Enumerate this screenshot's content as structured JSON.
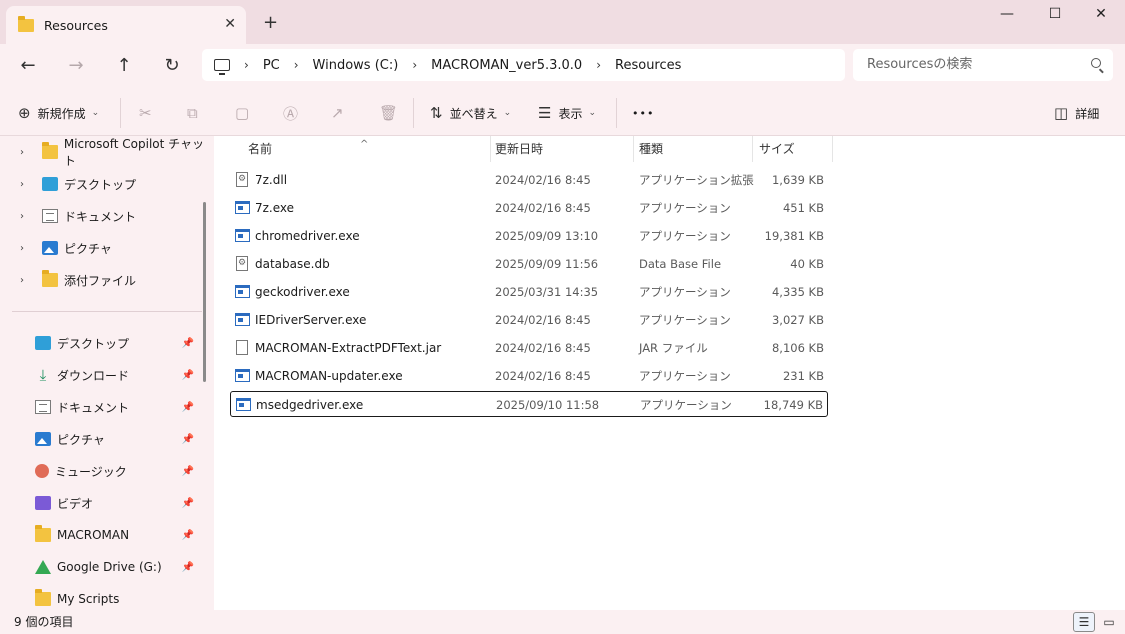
{
  "tab": {
    "title": "Resources"
  },
  "window": {
    "minimize": "—",
    "maximize": "☐",
    "close": "✕",
    "new_tab": "+"
  },
  "address": {
    "crumbs": [
      "PC",
      "Windows (C:)",
      "MACROMAN_ver5.3.0.0",
      "Resources"
    ],
    "search_placeholder": "Resourcesの検索"
  },
  "toolbar": {
    "new_label": "新規作成",
    "sort_label": "並べ替え",
    "view_label": "表示",
    "more_label": "•••",
    "details_label": "詳細"
  },
  "tree": [
    {
      "label": "Microsoft Copilot チャット",
      "icon": "folder-icon"
    },
    {
      "label": "デスクトップ",
      "icon": "desktop-icon"
    },
    {
      "label": "ドキュメント",
      "icon": "document-icon"
    },
    {
      "label": "ピクチャ",
      "icon": "pictures-icon"
    },
    {
      "label": "添付ファイル",
      "icon": "folder-icon"
    }
  ],
  "quick_access": [
    {
      "label": "デスクトップ",
      "icon": "desktop-icon"
    },
    {
      "label": "ダウンロード",
      "icon": "download-icon"
    },
    {
      "label": "ドキュメント",
      "icon": "document-icon"
    },
    {
      "label": "ピクチャ",
      "icon": "pictures-icon"
    },
    {
      "label": "ミュージック",
      "icon": "music-icon"
    },
    {
      "label": "ビデオ",
      "icon": "video-icon"
    },
    {
      "label": "MACROMAN",
      "icon": "folder-icon"
    },
    {
      "label": "Google Drive (G:)",
      "icon": "google-drive-icon"
    },
    {
      "label": "My Scripts",
      "icon": "folder-icon"
    }
  ],
  "columns": {
    "name": "名前",
    "date": "更新日時",
    "type": "種類",
    "size": "サイズ"
  },
  "files": [
    {
      "name": "7z.dll",
      "date": "2024/02/16 8:45",
      "type": "アプリケーション拡張",
      "size": "1,639 KB",
      "icon": "dll-file-icon"
    },
    {
      "name": "7z.exe",
      "date": "2024/02/16 8:45",
      "type": "アプリケーション",
      "size": "451 KB",
      "icon": "exe-file-icon"
    },
    {
      "name": "chromedriver.exe",
      "date": "2025/09/09 13:10",
      "type": "アプリケーション",
      "size": "19,381 KB",
      "icon": "exe-file-icon"
    },
    {
      "name": "database.db",
      "date": "2025/09/09 11:56",
      "type": "Data Base File",
      "size": "40 KB",
      "icon": "db-file-icon"
    },
    {
      "name": "geckodriver.exe",
      "date": "2025/03/31 14:35",
      "type": "アプリケーション",
      "size": "4,335 KB",
      "icon": "exe-file-icon"
    },
    {
      "name": "IEDriverServer.exe",
      "date": "2024/02/16 8:45",
      "type": "アプリケーション",
      "size": "3,027 KB",
      "icon": "exe-file-icon"
    },
    {
      "name": "MACROMAN-ExtractPDFText.jar",
      "date": "2024/02/16 8:45",
      "type": "JAR ファイル",
      "size": "8,106 KB",
      "icon": "jar-file-icon"
    },
    {
      "name": "MACROMAN-updater.exe",
      "date": "2024/02/16 8:45",
      "type": "アプリケーション",
      "size": "231 KB",
      "icon": "exe-file-icon"
    },
    {
      "name": "msedgedriver.exe",
      "date": "2025/09/10 11:58",
      "type": "アプリケーション",
      "size": "18,749 KB",
      "icon": "exe-file-icon"
    }
  ],
  "status": {
    "count": "9 個の項目"
  }
}
